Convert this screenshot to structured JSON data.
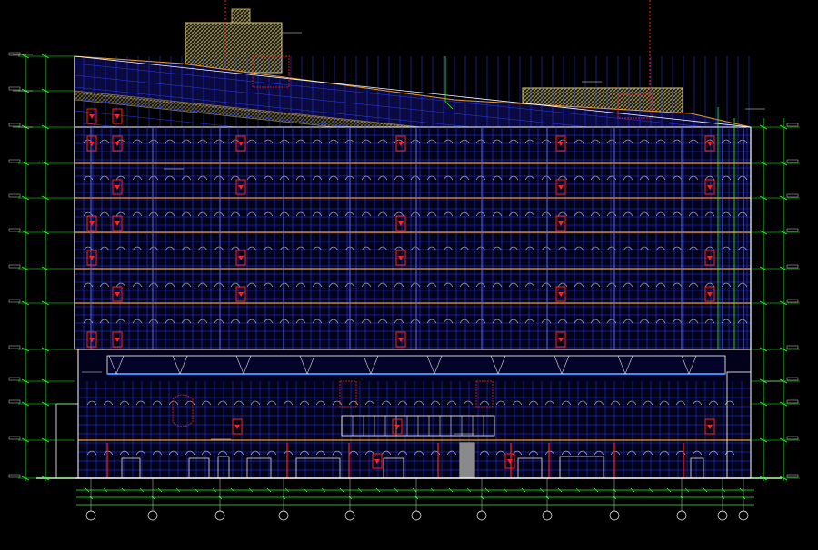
{
  "drawing": {
    "title_text": "",
    "background_color": "#000000",
    "palette": {
      "facade_grid": "#2e3cf0",
      "slab_line": "#f0a020",
      "red_opening": "#ff2020",
      "dimension": "#22ff22",
      "roof_hatch": "#d8c870",
      "white_detail": "#e8e8e8",
      "grey_panel": "#8a8a8a"
    },
    "icons": [
      "arrow-down-icon",
      "grid-bubble-icon",
      "elevation-marker-icon"
    ]
  }
}
